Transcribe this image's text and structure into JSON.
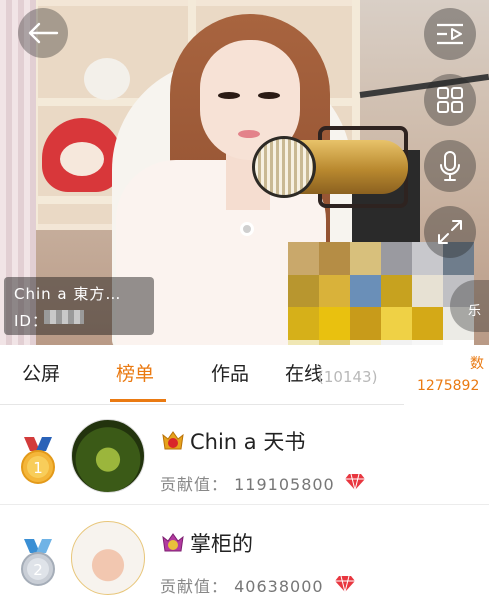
{
  "stream": {
    "streamer_name": "Chin a 東方…",
    "streamer_id_label": "ID："
  },
  "controls": {
    "back": "back-arrow-icon",
    "side_buttons": [
      "playlist-icon",
      "grid-icon",
      "microphone-icon",
      "fullscreen-icon"
    ],
    "side_partial_text": "乐"
  },
  "tabs": {
    "items": [
      {
        "label": "公屏"
      },
      {
        "label": "榜单"
      },
      {
        "label": "作品"
      },
      {
        "label": "在线"
      }
    ],
    "active_index": 1,
    "online_count": "(10143)",
    "stat_label": "数",
    "stat_value": "1275892",
    "accent": "#ea7a12"
  },
  "ranking": {
    "contrib_label": "贡献值：",
    "rows": [
      {
        "rank": "1",
        "name": "Chin a 天书",
        "value": "119105800"
      },
      {
        "rank": "2",
        "name": "掌柜的",
        "value": "40638000"
      }
    ]
  }
}
